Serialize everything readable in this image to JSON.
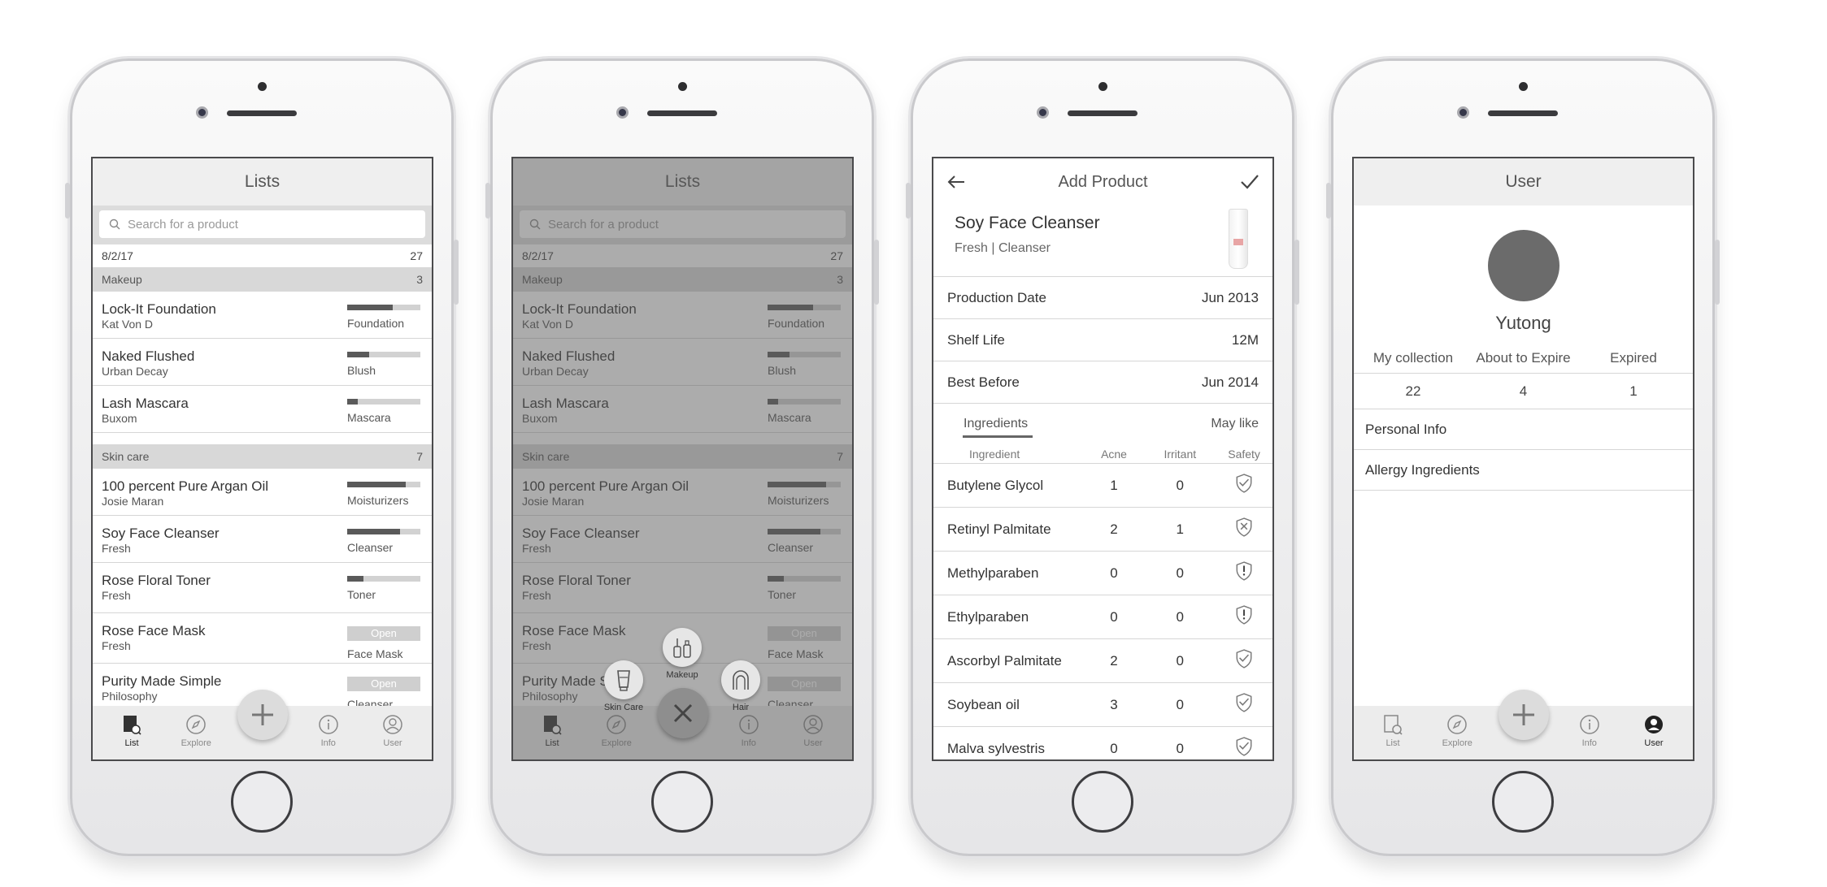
{
  "lists_screen": {
    "title": "Lists",
    "search_placeholder": "Search for a product",
    "date": "8/2/17",
    "date_count": "27",
    "sections": [
      {
        "name": "Makeup",
        "count": "3",
        "items": [
          {
            "name": "Lock-It Foundation",
            "brand": "Kat Von D",
            "category": "Foundation",
            "level": 0.62
          },
          {
            "name": "Naked Flushed",
            "brand": "Urban Decay",
            "category": "Blush",
            "level": 0.3
          },
          {
            "name": "Lash Mascara",
            "brand": "Buxom",
            "category": "Mascara",
            "level": 0.14
          }
        ]
      },
      {
        "name": "Skin care",
        "count": "7",
        "items": [
          {
            "name": "100 percent Pure Argan Oil",
            "brand": "Josie Maran",
            "category": "Moisturizers",
            "level": 0.8
          },
          {
            "name": "Soy Face Cleanser",
            "brand": "Fresh",
            "category": "Cleanser",
            "level": 0.72
          },
          {
            "name": "Rose Floral Toner",
            "brand": "Fresh",
            "category": "Toner",
            "level": 0.22
          },
          {
            "name": "Rose Face Mask",
            "brand": "Fresh",
            "category": "Face Mask",
            "badge": "Open"
          },
          {
            "name": "Purity Made Simple",
            "brand": "Philosophy",
            "category": "Cleanser",
            "badge": "Open"
          }
        ]
      }
    ]
  },
  "tabbar": {
    "list": "List",
    "explore": "Explore",
    "info": "Info",
    "user": "User"
  },
  "quick_add": {
    "skin_care": "Skin Care",
    "makeup": "Makeup",
    "hair": "Hair"
  },
  "add_product": {
    "title": "Add Product",
    "product_name": "Soy Face Cleanser",
    "product_sub": "Fresh | Cleanser",
    "fields": [
      {
        "label": "Production Date",
        "value": "Jun 2013"
      },
      {
        "label": "Shelf Life",
        "value": "12M"
      },
      {
        "label": "Best Before",
        "value": "Jun 2014"
      }
    ],
    "tabs": {
      "ingredients": "Ingredients",
      "may_like": "May like"
    },
    "columns": {
      "ingredient": "Ingredient",
      "acne": "Acne",
      "irritant": "Irritant",
      "safety": "Safety"
    },
    "ingredients": [
      {
        "name": "Butylene Glycol",
        "acne": "1",
        "irritant": "0",
        "safety": "check"
      },
      {
        "name": "Retinyl Palmitate",
        "acne": "2",
        "irritant": "1",
        "safety": "cross"
      },
      {
        "name": "Methylparaben",
        "acne": "0",
        "irritant": "0",
        "safety": "warn"
      },
      {
        "name": "Ethylparaben",
        "acne": "0",
        "irritant": "0",
        "safety": "warn"
      },
      {
        "name": "Ascorbyl Palmitate",
        "acne": "2",
        "irritant": "0",
        "safety": "check"
      },
      {
        "name": "Soybean oil",
        "acne": "3",
        "irritant": "0",
        "safety": "check"
      },
      {
        "name": "Malva sylvestris",
        "acne": "0",
        "irritant": "0",
        "safety": "check"
      }
    ]
  },
  "user_screen": {
    "title": "User",
    "name": "Yutong",
    "stats_labels": [
      "My collection",
      "About to Expire",
      "Expired"
    ],
    "stats_values": [
      "22",
      "4",
      "1"
    ],
    "rows": [
      "Personal Info",
      "Allergy Ingredients"
    ]
  }
}
